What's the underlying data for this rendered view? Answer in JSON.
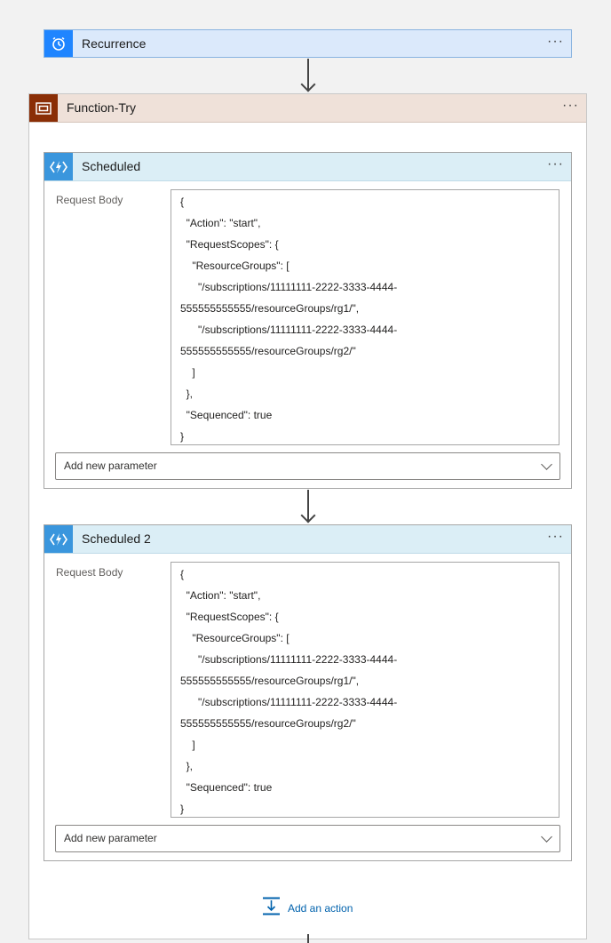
{
  "recurrence": {
    "title": "Recurrence",
    "menu": "···",
    "icon": "alarm-clock-icon",
    "color": "#1f85ff"
  },
  "scope": {
    "title": "Function-Try",
    "menu": "···",
    "icon": "scope-icon",
    "color": "#8a2e06"
  },
  "actions": [
    {
      "title": "Scheduled",
      "menu": "···",
      "icon": "azure-function-icon",
      "request_body_label": "Request Body",
      "body_lines": [
        "{",
        "  \"Action\": \"start\",",
        "  \"RequestScopes\": {",
        "    \"ResourceGroups\": [",
        "      \"/subscriptions/11111111-2222-3333-4444-",
        "555555555555/resourceGroups/rg1/\",",
        "      \"/subscriptions/11111111-2222-3333-4444-",
        "555555555555/resourceGroups/rg2/\"",
        "    ]",
        "  },",
        "  \"Sequenced\": true",
        "}"
      ],
      "add_param_label": "Add new parameter"
    },
    {
      "title": "Scheduled 2",
      "menu": "···",
      "icon": "azure-function-icon",
      "request_body_label": "Request Body",
      "body_lines": [
        "{",
        "  \"Action\": \"start\",",
        "  \"RequestScopes\": {",
        "    \"ResourceGroups\": [",
        "      \"/subscriptions/11111111-2222-3333-4444-",
        "555555555555/resourceGroups/rg1/\",",
        "      \"/subscriptions/11111111-2222-3333-4444-",
        "555555555555/resourceGroups/rg2/\"",
        "    ]",
        "  },",
        "  \"Sequenced\": true",
        "}"
      ],
      "add_param_label": "Add new parameter"
    }
  ],
  "add_action": {
    "label": "Add an action",
    "icon": "insert-step-icon",
    "color": "#0062ad"
  }
}
